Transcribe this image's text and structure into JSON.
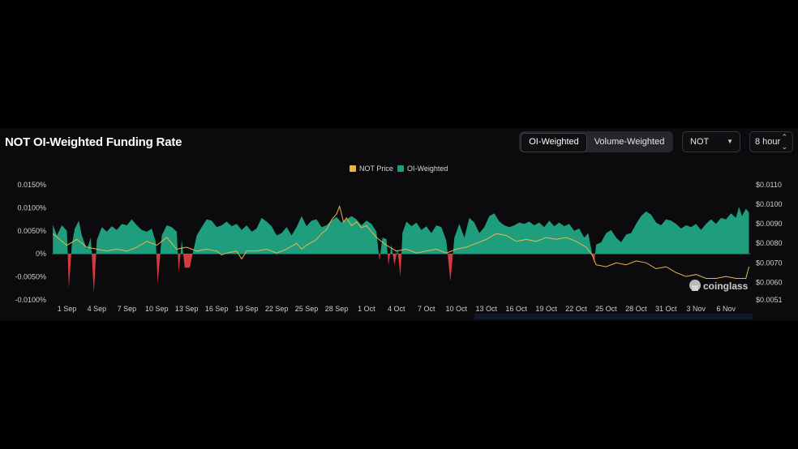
{
  "title": "NOT OI-Weighted Funding Rate",
  "toggle": {
    "options": [
      "OI-Weighted",
      "Volume-Weighted"
    ],
    "selected": "OI-Weighted"
  },
  "symbol_select": {
    "value": "NOT"
  },
  "interval_select": {
    "value": "8 hour"
  },
  "watermark": "coinglass",
  "colors": {
    "background": "#0b0b0e",
    "positive_area": "#1f9e7e",
    "negative_area": "#d63a3a",
    "price_line": "#e8b64c",
    "axis_text": "#cfcfcf"
  },
  "chart_data": {
    "type": "area",
    "title": "",
    "legend": {
      "position": "top-center",
      "entries": [
        "NOT Price",
        "OI-Weighted"
      ]
    },
    "x_tick_labels": [
      "1 Sep",
      "4 Sep",
      "7 Sep",
      "10 Sep",
      "13 Sep",
      "16 Sep",
      "19 Sep",
      "22 Sep",
      "25 Sep",
      "28 Sep",
      "1 Oct",
      "4 Oct",
      "7 Oct",
      "10 Oct",
      "13 Oct",
      "16 Oct",
      "19 Oct",
      "22 Oct",
      "25 Oct",
      "28 Oct",
      "31 Oct",
      "3 Nov",
      "6 Nov"
    ],
    "x_range_days": [
      -1.5,
      68.5
    ],
    "x_unit": "days from 1 Sep",
    "y_left": {
      "ticks": [
        "0.0150%",
        "0.0100%",
        "0.0050%",
        "0%",
        "-0.0050%",
        "-0.0100%"
      ],
      "range": [
        -0.01,
        0.015
      ]
    },
    "y_right": {
      "ticks": [
        "$0.0110",
        "$0.0100",
        "$0.0090",
        "$0.0080",
        "$0.0070",
        "$0.0060",
        "$0.0051"
      ],
      "range": [
        0.0051,
        0.011
      ]
    },
    "grid": false,
    "series": [
      {
        "name": "OI-Weighted",
        "axis": "left",
        "points": [
          [
            -1.4,
            0.0063
          ],
          [
            -1.0,
            0.004
          ],
          [
            -0.5,
            0.0062
          ],
          [
            0.0,
            0.005
          ],
          [
            0.2,
            -0.0075
          ],
          [
            0.5,
            0.002
          ],
          [
            0.8,
            0.0055
          ],
          [
            1.2,
            0.0072
          ],
          [
            1.5,
            0.004
          ],
          [
            2.0,
            0.001
          ],
          [
            2.4,
            0.0035
          ],
          [
            2.7,
            -0.0085
          ],
          [
            3.0,
            0.003
          ],
          [
            3.5,
            0.0058
          ],
          [
            4.0,
            0.0048
          ],
          [
            4.5,
            0.006
          ],
          [
            5.0,
            0.0052
          ],
          [
            5.5,
            0.0065
          ],
          [
            6.0,
            0.0062
          ],
          [
            6.5,
            0.0075
          ],
          [
            7.0,
            0.0062
          ],
          [
            7.5,
            0.0052
          ],
          [
            8.0,
            0.0048
          ],
          [
            8.5,
            0.0055
          ],
          [
            8.9,
            0.0025
          ],
          [
            9.1,
            -0.0065
          ],
          [
            9.5,
            0.004
          ],
          [
            10.0,
            0.0062
          ],
          [
            10.5,
            0.0058
          ],
          [
            11.0,
            0.0048
          ],
          [
            11.2,
            -0.004
          ],
          [
            11.5,
            0.003
          ],
          [
            11.8,
            -0.003
          ],
          [
            12.3,
            -0.003
          ],
          [
            12.6,
            0.0
          ],
          [
            13.0,
            0.004
          ],
          [
            13.5,
            0.0058
          ],
          [
            14.0,
            0.0075
          ],
          [
            14.5,
            0.0072
          ],
          [
            15.0,
            0.0058
          ],
          [
            15.5,
            0.0062
          ],
          [
            16.0,
            0.007
          ],
          [
            16.5,
            0.006
          ],
          [
            17.0,
            0.0065
          ],
          [
            17.5,
            0.0052
          ],
          [
            18.0,
            0.0062
          ],
          [
            18.5,
            0.0048
          ],
          [
            19.0,
            0.0055
          ],
          [
            19.5,
            0.0078
          ],
          [
            20.0,
            0.007
          ],
          [
            20.5,
            0.006
          ],
          [
            21.0,
            0.004
          ],
          [
            21.5,
            0.0045
          ],
          [
            22.0,
            0.0058
          ],
          [
            22.5,
            0.004
          ],
          [
            23.0,
            0.0058
          ],
          [
            23.5,
            0.0082
          ],
          [
            24.0,
            0.006
          ],
          [
            24.5,
            0.0072
          ],
          [
            25.0,
            0.0075
          ],
          [
            25.5,
            0.0058
          ],
          [
            26.0,
            0.0062
          ],
          [
            26.5,
            0.0072
          ],
          [
            27.0,
            0.008
          ],
          [
            27.5,
            0.0068
          ],
          [
            28.0,
            0.0075
          ],
          [
            28.5,
            0.0082
          ],
          [
            29.0,
            0.0075
          ],
          [
            29.5,
            0.0062
          ],
          [
            30.0,
            0.0072
          ],
          [
            30.5,
            0.0065
          ],
          [
            31.0,
            0.0048
          ],
          [
            31.3,
            -0.0015
          ],
          [
            31.6,
            0.0035
          ],
          [
            32.0,
            0.0032
          ],
          [
            32.2,
            -0.0025
          ],
          [
            32.5,
            0.002
          ],
          [
            32.8,
            -0.0025
          ],
          [
            33.1,
            0.001
          ],
          [
            33.4,
            -0.005
          ],
          [
            33.6,
            0.0045
          ],
          [
            34.0,
            0.007
          ],
          [
            34.5,
            0.006
          ],
          [
            35.0,
            0.0068
          ],
          [
            35.5,
            0.0052
          ],
          [
            36.0,
            0.006
          ],
          [
            36.5,
            0.0045
          ],
          [
            37.0,
            0.0062
          ],
          [
            37.5,
            0.0058
          ],
          [
            38.0,
            0.0028
          ],
          [
            38.4,
            -0.006
          ],
          [
            38.8,
            0.0035
          ],
          [
            39.3,
            0.0065
          ],
          [
            39.8,
            0.0035
          ],
          [
            40.3,
            0.0078
          ],
          [
            40.8,
            0.0068
          ],
          [
            41.3,
            0.0045
          ],
          [
            41.8,
            0.0058
          ],
          [
            42.3,
            0.0082
          ],
          [
            42.8,
            0.0088
          ],
          [
            43.3,
            0.007
          ],
          [
            43.8,
            0.0062
          ],
          [
            44.3,
            0.0058
          ],
          [
            44.8,
            0.0062
          ],
          [
            45.3,
            0.0068
          ],
          [
            45.8,
            0.0065
          ],
          [
            46.3,
            0.007
          ],
          [
            46.8,
            0.0062
          ],
          [
            47.3,
            0.0068
          ],
          [
            47.8,
            0.0058
          ],
          [
            48.3,
            0.0072
          ],
          [
            48.8,
            0.006
          ],
          [
            49.3,
            0.0068
          ],
          [
            49.8,
            0.006
          ],
          [
            50.3,
            0.0065
          ],
          [
            50.8,
            0.005
          ],
          [
            51.3,
            0.0055
          ],
          [
            51.8,
            0.0035
          ],
          [
            52.2,
            0.0045
          ],
          [
            52.6,
            0.0
          ],
          [
            52.8,
            -0.002
          ],
          [
            53.0,
            0.002
          ],
          [
            53.5,
            0.0025
          ],
          [
            54.0,
            0.0045
          ],
          [
            54.5,
            0.0052
          ],
          [
            55.0,
            0.0035
          ],
          [
            55.5,
            0.0025
          ],
          [
            56.0,
            0.0042
          ],
          [
            56.5,
            0.0045
          ],
          [
            57.0,
            0.0065
          ],
          [
            57.5,
            0.0082
          ],
          [
            58.0,
            0.0092
          ],
          [
            58.5,
            0.0085
          ],
          [
            59.0,
            0.0068
          ],
          [
            59.5,
            0.0062
          ],
          [
            60.0,
            0.0075
          ],
          [
            60.5,
            0.0072
          ],
          [
            61.0,
            0.0065
          ],
          [
            61.5,
            0.0055
          ],
          [
            62.0,
            0.0062
          ],
          [
            62.5,
            0.0058
          ],
          [
            63.0,
            0.0065
          ],
          [
            63.5,
            0.0052
          ],
          [
            64.0,
            0.0065
          ],
          [
            64.5,
            0.0075
          ],
          [
            65.0,
            0.0065
          ],
          [
            65.5,
            0.0078
          ],
          [
            66.0,
            0.0075
          ],
          [
            66.5,
            0.0088
          ],
          [
            67.0,
            0.0078
          ],
          [
            67.3,
            0.0102
          ],
          [
            67.6,
            0.0082
          ],
          [
            68.0,
            0.0098
          ],
          [
            68.3,
            0.009
          ]
        ]
      },
      {
        "name": "NOT Price",
        "axis": "right",
        "points": [
          [
            -1.4,
            0.0085
          ],
          [
            -0.5,
            0.0081
          ],
          [
            0.0,
            0.0079
          ],
          [
            1.0,
            0.0082
          ],
          [
            2.0,
            0.0078
          ],
          [
            3.0,
            0.0077
          ],
          [
            4.0,
            0.0076
          ],
          [
            5.0,
            0.0077
          ],
          [
            6.0,
            0.0076
          ],
          [
            7.0,
            0.0078
          ],
          [
            8.0,
            0.0081
          ],
          [
            9.0,
            0.0079
          ],
          [
            10.0,
            0.0083
          ],
          [
            11.0,
            0.0077
          ],
          [
            12.0,
            0.0078
          ],
          [
            13.0,
            0.0076
          ],
          [
            14.0,
            0.0077
          ],
          [
            15.0,
            0.0076
          ],
          [
            15.5,
            0.0074
          ],
          [
            16.0,
            0.0075
          ],
          [
            17.0,
            0.0076
          ],
          [
            17.5,
            0.0072
          ],
          [
            18.0,
            0.0076
          ],
          [
            19.0,
            0.0076
          ],
          [
            20.0,
            0.0077
          ],
          [
            21.0,
            0.0075
          ],
          [
            22.0,
            0.0077
          ],
          [
            23.0,
            0.008
          ],
          [
            23.5,
            0.0077
          ],
          [
            24.0,
            0.0079
          ],
          [
            25.0,
            0.0082
          ],
          [
            25.5,
            0.0085
          ],
          [
            26.0,
            0.0087
          ],
          [
            26.5,
            0.0092
          ],
          [
            27.0,
            0.0095
          ],
          [
            27.3,
            0.0099
          ],
          [
            27.7,
            0.0091
          ],
          [
            28.0,
            0.0093
          ],
          [
            28.5,
            0.0089
          ],
          [
            29.0,
            0.0091
          ],
          [
            29.5,
            0.0088
          ],
          [
            30.0,
            0.0089
          ],
          [
            30.5,
            0.0086
          ],
          [
            31.0,
            0.0083
          ],
          [
            32.0,
            0.0079
          ],
          [
            33.0,
            0.0076
          ],
          [
            34.0,
            0.0077
          ],
          [
            35.0,
            0.0075
          ],
          [
            36.0,
            0.0076
          ],
          [
            37.0,
            0.0077
          ],
          [
            38.0,
            0.0075
          ],
          [
            39.0,
            0.0077
          ],
          [
            40.0,
            0.0078
          ],
          [
            41.0,
            0.008
          ],
          [
            42.0,
            0.0082
          ],
          [
            43.0,
            0.0085
          ],
          [
            44.0,
            0.0084
          ],
          [
            45.0,
            0.0081
          ],
          [
            46.0,
            0.0082
          ],
          [
            47.0,
            0.0081
          ],
          [
            48.0,
            0.0083
          ],
          [
            49.0,
            0.0082
          ],
          [
            50.0,
            0.0083
          ],
          [
            51.0,
            0.0081
          ],
          [
            52.0,
            0.0078
          ],
          [
            52.6,
            0.0074
          ],
          [
            53.0,
            0.0069
          ],
          [
            54.0,
            0.0068
          ],
          [
            55.0,
            0.007
          ],
          [
            56.0,
            0.0069
          ],
          [
            57.0,
            0.0071
          ],
          [
            58.0,
            0.007
          ],
          [
            59.0,
            0.0067
          ],
          [
            60.0,
            0.0068
          ],
          [
            61.0,
            0.0065
          ],
          [
            62.0,
            0.0063
          ],
          [
            63.0,
            0.0064
          ],
          [
            64.0,
            0.0062
          ],
          [
            65.0,
            0.0062
          ],
          [
            66.0,
            0.0063
          ],
          [
            67.0,
            0.0062
          ],
          [
            68.0,
            0.0062
          ],
          [
            68.3,
            0.0068
          ]
        ]
      }
    ]
  }
}
